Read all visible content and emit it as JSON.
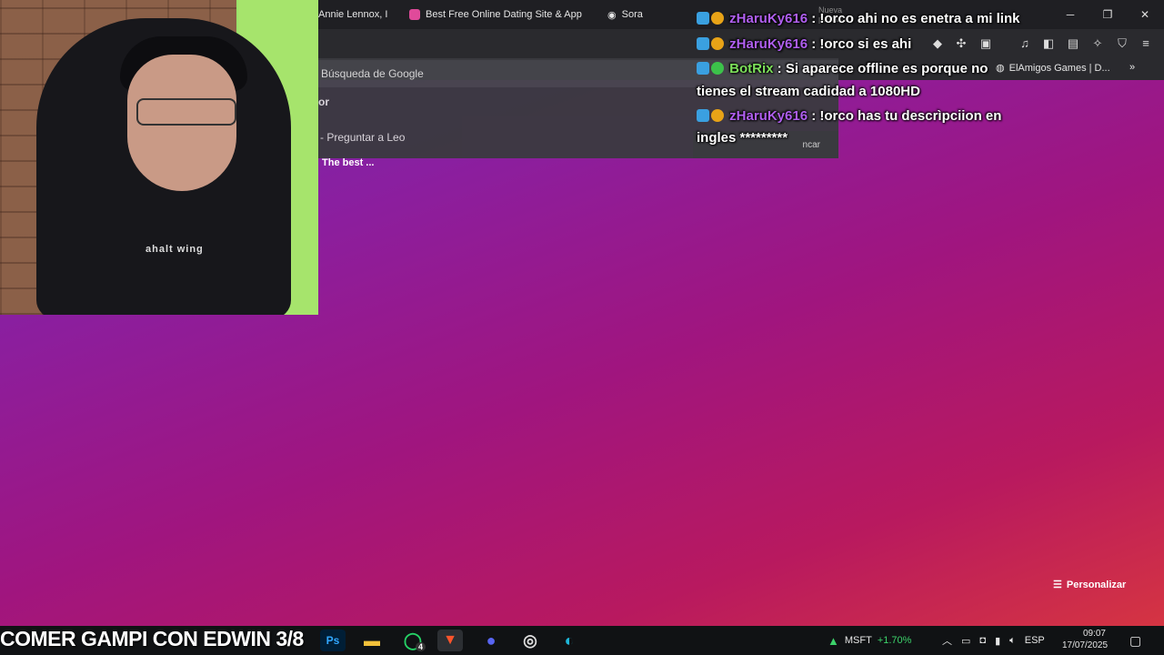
{
  "browser": {
    "tabs": [
      {
        "label": "Annie Lennox, I",
        "icon": "music-icon"
      },
      {
        "label": "Best Free Online Dating Site & App",
        "icon": "heart-icon"
      },
      {
        "label": "Sora",
        "icon": "sora-icon"
      }
    ],
    "bookmark_right": "ElAmigos Games | D...",
    "dropdown": {
      "rows": [
        "Búsqueda de Google",
        "or",
        "Preguntar a Leo"
      ],
      "right_fragment": "ncar",
      "best_label": "The best ..."
    },
    "tab_ghost": "Nueva pestaña"
  },
  "chat": {
    "messages": [
      {
        "user": "zHaruKy616",
        "text": " : !orco ahi no es enetra a mi link",
        "user_color": "#b05ff0"
      },
      {
        "user": "zHaruKy616",
        "text": " : !orco si es ahi",
        "user_color": "#b05ff0"
      },
      {
        "user": "BotRix",
        "text": " : Si aparece offline es porque no",
        "cont": "tienes el stream cadidad a 1080HD",
        "user_color": "#7ce05a"
      },
      {
        "user": "zHaruKy616",
        "text": " : !orco has tu descrìpciion en",
        "cont": "ingles *********",
        "user_color": "#b05ff0"
      }
    ]
  },
  "newtab": {
    "customize_label": "Personalizar"
  },
  "webcam": {
    "shirt_text": "ahalt wing"
  },
  "taskbar": {
    "ticker": "COMER GAMPI CON EDWIN 3/8",
    "apps": [
      "Ps",
      "folder",
      "whatsapp",
      "brave",
      "discord",
      "obs",
      "edge"
    ],
    "whatsapp_badge": "4",
    "stock_symbol": "MSFT",
    "stock_change": "+1.70%",
    "language": "ESP",
    "time": "09:07",
    "date": "17/07/2025"
  },
  "colors": {
    "username_purple": "#b05ff0",
    "username_green": "#7ce05a",
    "stock_green": "#3cd26a"
  }
}
